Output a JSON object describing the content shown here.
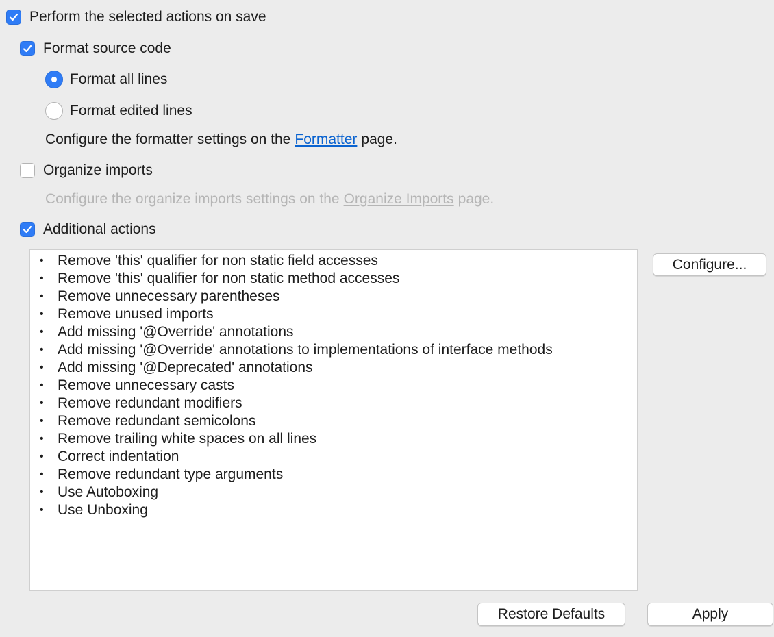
{
  "perform_on_save": {
    "label": "Perform the selected actions on save",
    "checked": true
  },
  "format_source": {
    "label": "Format source code",
    "checked": true,
    "options": [
      {
        "label": "Format all lines",
        "selected": true
      },
      {
        "label": "Format edited lines",
        "selected": false
      }
    ],
    "note_prefix": "Configure the formatter settings on the",
    "note_link": "Formatter",
    "note_suffix": "page."
  },
  "organize_imports": {
    "label": "Organize imports",
    "checked": false,
    "note_prefix": "Configure the organize imports settings on the",
    "note_link": "Organize Imports",
    "note_suffix": "page."
  },
  "additional_actions": {
    "label": "Additional actions",
    "checked": true,
    "items": [
      "Remove 'this' qualifier for non static field accesses",
      "Remove 'this' qualifier for non static method accesses",
      "Remove unnecessary parentheses",
      "Remove unused imports",
      "Add missing '@Override' annotations",
      "Add missing '@Override' annotations to implementations of interface methods",
      "Add missing '@Deprecated' annotations",
      "Remove unnecessary casts",
      "Remove redundant modifiers",
      "Remove redundant semicolons",
      "Remove trailing white spaces on all lines",
      "Correct indentation",
      "Remove redundant type arguments",
      "Use Autoboxing",
      "Use Unboxing"
    ],
    "configure_label": "Configure..."
  },
  "buttons": {
    "restore_defaults": "Restore Defaults",
    "apply": "Apply"
  },
  "colors": {
    "accent": "#2f7cf6",
    "link": "#0a63d0",
    "disabled": "#b5b5b5",
    "background": "#ececec"
  }
}
